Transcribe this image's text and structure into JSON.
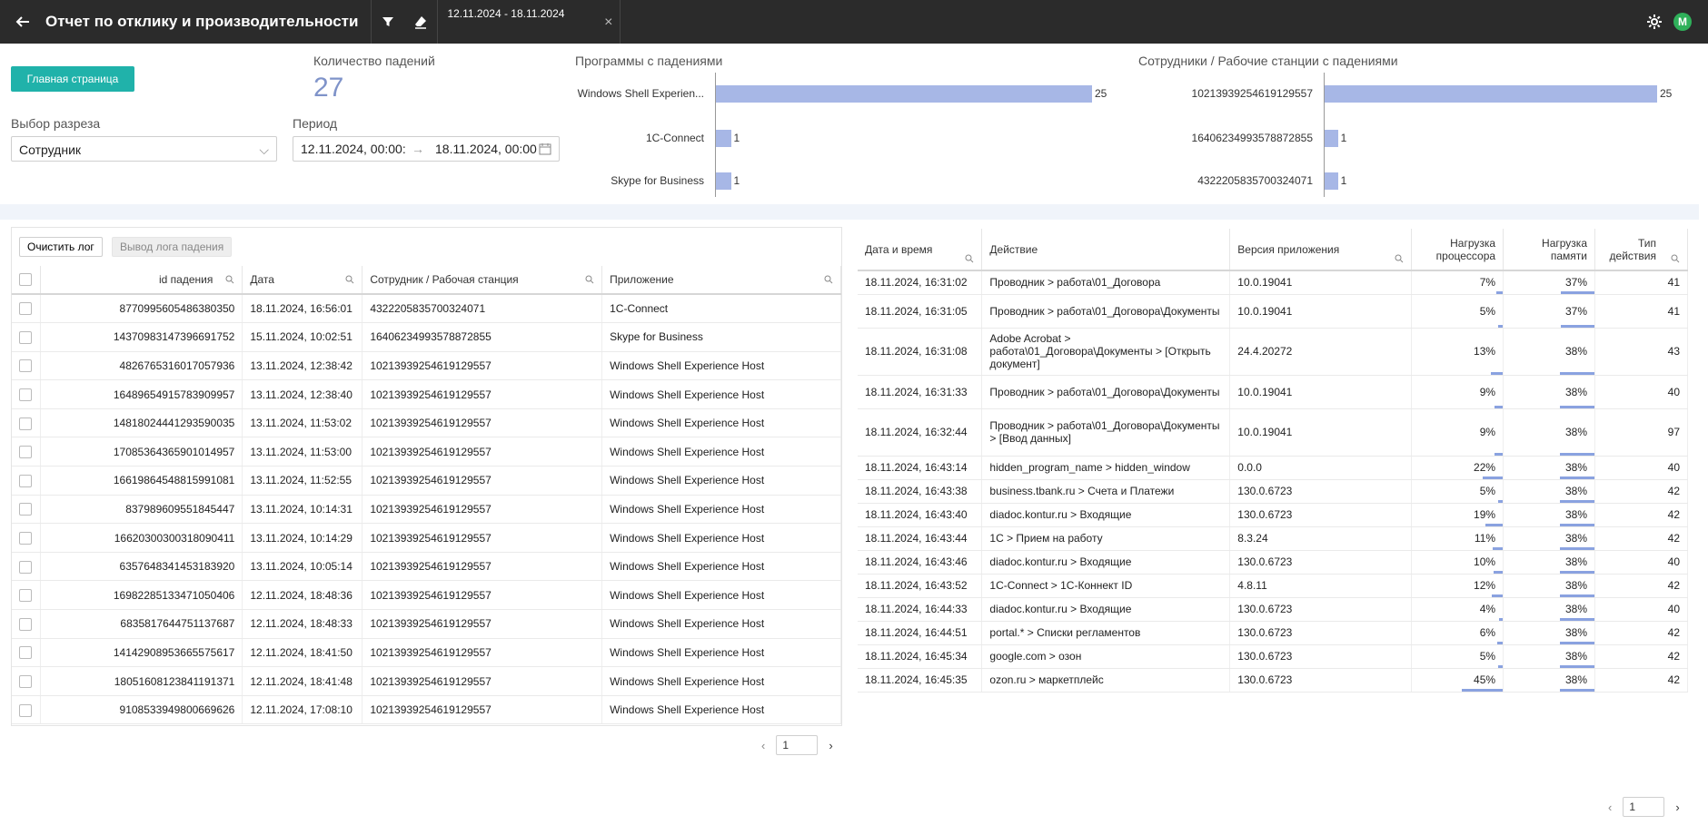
{
  "topbar": {
    "title": "Отчет по отклику и производительности",
    "date_chip": "12.11.2024 - 18.11.2024",
    "avatar_letter": "M"
  },
  "header": {
    "home_button": "Главная страница",
    "crash_count_label": "Количество падений",
    "crash_count": "27",
    "slice_label": "Выбор разреза",
    "slice_value": "Сотрудник",
    "period_label": "Период",
    "period_from": "12.11.2024, 00:00:",
    "period_to": "18.11.2024, 00:00:"
  },
  "chart_data": [
    {
      "type": "bar",
      "title": "Программы с падениями",
      "categories": [
        "Windows Shell Experien...",
        "1C-Connect",
        "Skype for Business"
      ],
      "values": [
        25,
        1,
        1
      ]
    },
    {
      "type": "bar",
      "title": "Сотрудники / Рабочие станции с падениями",
      "categories": [
        "10213939254619129557",
        "16406234993578872855",
        "4322205835700324071"
      ],
      "values": [
        25,
        1,
        1
      ]
    }
  ],
  "left_panel": {
    "clear_button": "Очистить лог",
    "output_button": "Вывод лога падения",
    "columns": [
      "id падения",
      "Дата",
      "Сотрудник / Рабочая станция",
      "Приложение"
    ],
    "rows": [
      [
        "8770995605486380350",
        "18.11.2024, 16:56:01",
        "4322205835700324071",
        "1C-Connect"
      ],
      [
        "14370983147396691752",
        "15.11.2024, 10:02:51",
        "16406234993578872855",
        "Skype for Business"
      ],
      [
        "4826765316017057936",
        "13.11.2024, 12:38:42",
        "10213939254619129557",
        "Windows Shell Experience Host"
      ],
      [
        "16489654915783909957",
        "13.11.2024, 12:38:40",
        "10213939254619129557",
        "Windows Shell Experience Host"
      ],
      [
        "14818024441293590035",
        "13.11.2024, 11:53:02",
        "10213939254619129557",
        "Windows Shell Experience Host"
      ],
      [
        "17085364365901014957",
        "13.11.2024, 11:53:00",
        "10213939254619129557",
        "Windows Shell Experience Host"
      ],
      [
        "16619864548815991081",
        "13.11.2024, 11:52:55",
        "10213939254619129557",
        "Windows Shell Experience Host"
      ],
      [
        "837989609551845447",
        "13.11.2024, 10:14:31",
        "10213939254619129557",
        "Windows Shell Experience Host"
      ],
      [
        "16620300300318090411",
        "13.11.2024, 10:14:29",
        "10213939254619129557",
        "Windows Shell Experience Host"
      ],
      [
        "6357648341453183920",
        "13.11.2024, 10:05:14",
        "10213939254619129557",
        "Windows Shell Experience Host"
      ],
      [
        "16982285133471050406",
        "12.11.2024, 18:48:36",
        "10213939254619129557",
        "Windows Shell Experience Host"
      ],
      [
        "6835817644751137687",
        "12.11.2024, 18:48:33",
        "10213939254619129557",
        "Windows Shell Experience Host"
      ],
      [
        "14142908953665575617",
        "12.11.2024, 18:41:50",
        "10213939254619129557",
        "Windows Shell Experience Host"
      ],
      [
        "18051608123841191371",
        "12.11.2024, 18:41:48",
        "10213939254619129557",
        "Windows Shell Experience Host"
      ],
      [
        "9108533949800669626",
        "12.11.2024, 17:08:10",
        "10213939254619129557",
        "Windows Shell Experience Host"
      ]
    ],
    "page": "1"
  },
  "right_panel": {
    "columns": [
      "Дата и время",
      "Действие",
      "Версия приложения",
      "Нагрузка процессора",
      "Нагрузка памяти",
      "Тип действия"
    ],
    "rows": [
      {
        "dt": "18.11.2024, 16:31:02",
        "action": "Проводник > работа\\01_Договора",
        "ver": "10.0.19041",
        "cpu": "7%",
        "cpu_v": 7,
        "mem": "37%",
        "mem_v": 37,
        "type": "41"
      },
      {
        "dt": "18.11.2024, 16:31:05",
        "action": "Проводник > работа\\01_Договора\\Документы",
        "ver": "10.0.19041",
        "cpu": "5%",
        "cpu_v": 5,
        "mem": "37%",
        "mem_v": 37,
        "type": "41"
      },
      {
        "dt": "18.11.2024, 16:31:08",
        "action": "Adobe Acrobat > работа\\01_Договора\\Документы > [Открыть документ]",
        "ver": "24.4.20272",
        "cpu": "13%",
        "cpu_v": 13,
        "mem": "38%",
        "mem_v": 38,
        "type": "43"
      },
      {
        "dt": "18.11.2024, 16:31:33",
        "action": "Проводник > работа\\01_Договора\\Документы",
        "ver": "10.0.19041",
        "cpu": "9%",
        "cpu_v": 9,
        "mem": "38%",
        "mem_v": 38,
        "type": "40"
      },
      {
        "dt": "18.11.2024, 16:32:44",
        "action": "Проводник > работа\\01_Договора\\Документы > [Ввод данных]",
        "ver": "10.0.19041",
        "cpu": "9%",
        "cpu_v": 9,
        "mem": "38%",
        "mem_v": 38,
        "type": "97"
      },
      {
        "dt": "18.11.2024, 16:43:14",
        "action": "hidden_program_name > hidden_window",
        "ver": "0.0.0",
        "cpu": "22%",
        "cpu_v": 22,
        "mem": "38%",
        "mem_v": 38,
        "type": "40"
      },
      {
        "dt": "18.11.2024, 16:43:38",
        "action": "business.tbank.ru > Счета и Платежи",
        "ver": "130.0.6723",
        "cpu": "5%",
        "cpu_v": 5,
        "mem": "38%",
        "mem_v": 38,
        "type": "42"
      },
      {
        "dt": "18.11.2024, 16:43:40",
        "action": "diadoc.kontur.ru > Входящие",
        "ver": "130.0.6723",
        "cpu": "19%",
        "cpu_v": 19,
        "mem": "38%",
        "mem_v": 38,
        "type": "42"
      },
      {
        "dt": "18.11.2024, 16:43:44",
        "action": "1С > Прием на работу",
        "ver": "8.3.24",
        "cpu": "11%",
        "cpu_v": 11,
        "mem": "38%",
        "mem_v": 38,
        "type": "42"
      },
      {
        "dt": "18.11.2024, 16:43:46",
        "action": "diadoc.kontur.ru > Входящие",
        "ver": "130.0.6723",
        "cpu": "10%",
        "cpu_v": 10,
        "mem": "38%",
        "mem_v": 38,
        "type": "40"
      },
      {
        "dt": "18.11.2024, 16:43:52",
        "action": "1C-Connect > 1С-Коннект ID",
        "ver": "4.8.11",
        "cpu": "12%",
        "cpu_v": 12,
        "mem": "38%",
        "mem_v": 38,
        "type": "42"
      },
      {
        "dt": "18.11.2024, 16:44:33",
        "action": "diadoc.kontur.ru > Входящие",
        "ver": "130.0.6723",
        "cpu": "4%",
        "cpu_v": 4,
        "mem": "38%",
        "mem_v": 38,
        "type": "40"
      },
      {
        "dt": "18.11.2024, 16:44:51",
        "action": "portal.* > Списки регламентов",
        "ver": "130.0.6723",
        "cpu": "6%",
        "cpu_v": 6,
        "mem": "38%",
        "mem_v": 38,
        "type": "42"
      },
      {
        "dt": "18.11.2024, 16:45:34",
        "action": "google.com > озон",
        "ver": "130.0.6723",
        "cpu": "5%",
        "cpu_v": 5,
        "mem": "38%",
        "mem_v": 38,
        "type": "42"
      },
      {
        "dt": "18.11.2024, 16:45:35",
        "action": "ozon.ru > маркетплейс",
        "ver": "130.0.6723",
        "cpu": "45%",
        "cpu_v": 45,
        "mem": "38%",
        "mem_v": 38,
        "type": "42"
      }
    ],
    "page": "1"
  }
}
